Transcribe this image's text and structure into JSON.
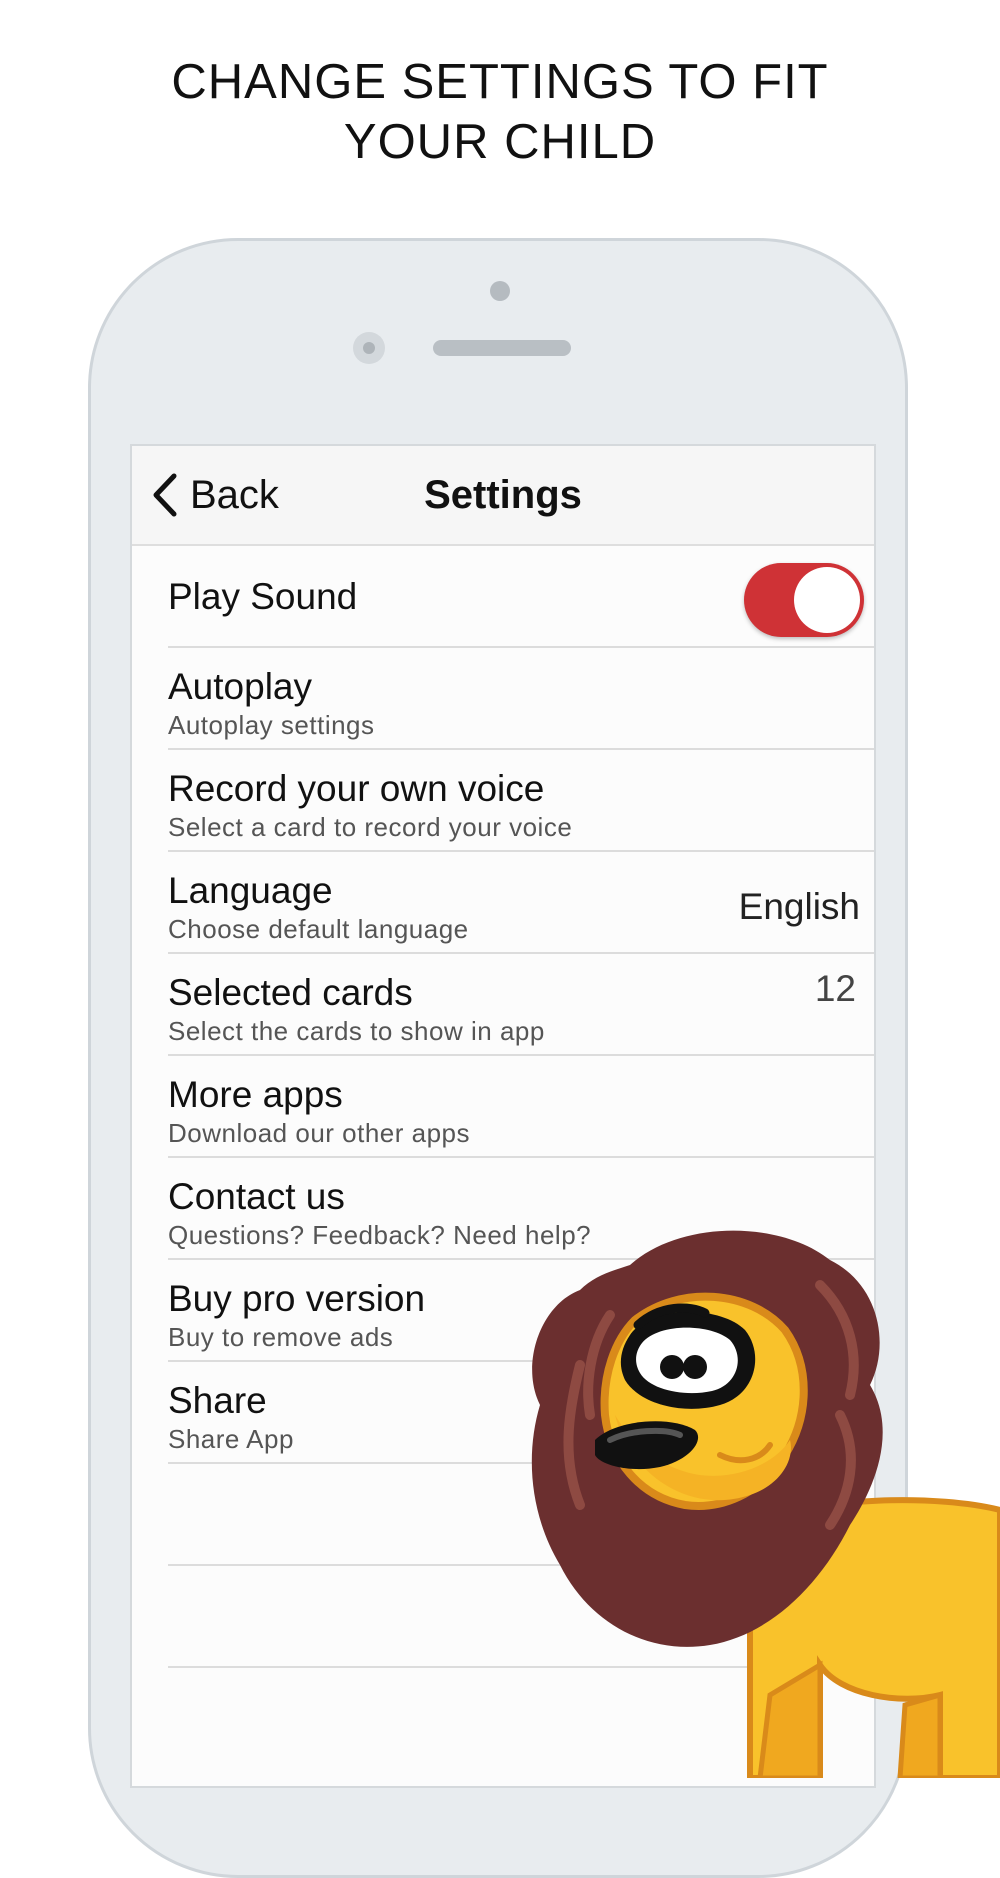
{
  "headline": {
    "line1": "CHANGE SETTINGS TO FIT",
    "line2": "YOUR CHILD"
  },
  "navbar": {
    "back_label": "Back",
    "title": "Settings"
  },
  "settings": {
    "play_sound": {
      "title": "Play Sound",
      "enabled": true
    },
    "autoplay": {
      "title": "Autoplay",
      "subtitle": "Autoplay settings"
    },
    "record_voice": {
      "title": "Record your own voice",
      "subtitle": "Select a card to record your voice"
    },
    "language": {
      "title": "Language",
      "subtitle": "Choose default language",
      "value": "English"
    },
    "selected_cards": {
      "title": "Selected cards",
      "subtitle": "Select the cards to show in app",
      "value": "12"
    },
    "more_apps": {
      "title": "More apps",
      "subtitle": "Download our other apps"
    },
    "contact": {
      "title": "Contact us",
      "subtitle": "Questions? Feedback? Need help?"
    },
    "buy_pro": {
      "title": "Buy pro version",
      "subtitle": "Buy to remove ads"
    },
    "share": {
      "title": "Share",
      "subtitle": "Share App"
    }
  },
  "colors": {
    "toggle_on": "#cf3236",
    "lion_body": "#f9c22b",
    "lion_mane": "#6b2f2f"
  }
}
